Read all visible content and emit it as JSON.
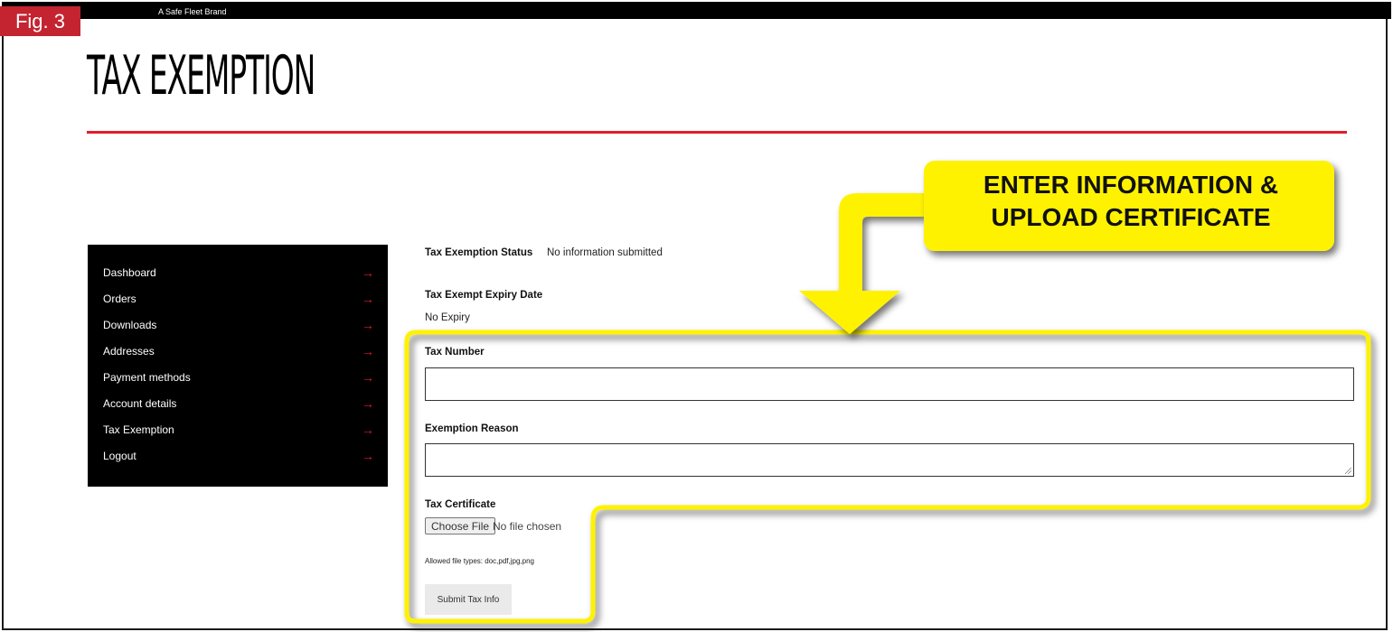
{
  "figure_label": "Fig. 3",
  "brand": "A Safe Fleet Brand",
  "page_title": "TAX EXEMPTION",
  "sidebar": {
    "items": [
      {
        "label": "Dashboard"
      },
      {
        "label": "Orders"
      },
      {
        "label": "Downloads"
      },
      {
        "label": "Addresses"
      },
      {
        "label": "Payment methods"
      },
      {
        "label": "Account details"
      },
      {
        "label": "Tax Exemption"
      },
      {
        "label": "Logout"
      }
    ],
    "arrow_glyph": "→"
  },
  "form": {
    "status_label": "Tax Exemption Status",
    "status_value": "No information submitted",
    "expiry_label": "Tax Exempt Expiry Date",
    "expiry_value": "No Expiry",
    "tax_number_label": "Tax Number",
    "tax_number_value": "",
    "reason_label": "Exemption Reason",
    "reason_value": "",
    "certificate_label": "Tax Certificate",
    "choose_file_label": "Choose File",
    "file_status": "No file chosen",
    "allowed_types": "Allowed file types: doc,pdf,jpg,png",
    "submit_label": "Submit Tax Info"
  },
  "callout": {
    "line1": "ENTER INFORMATION &",
    "line2": "UPLOAD CERTIFICATE",
    "color": "#fff200"
  },
  "colors": {
    "accent_red": "#e21d2a",
    "fig_tag": "#c42430",
    "sidebar_bg": "#000000"
  }
}
